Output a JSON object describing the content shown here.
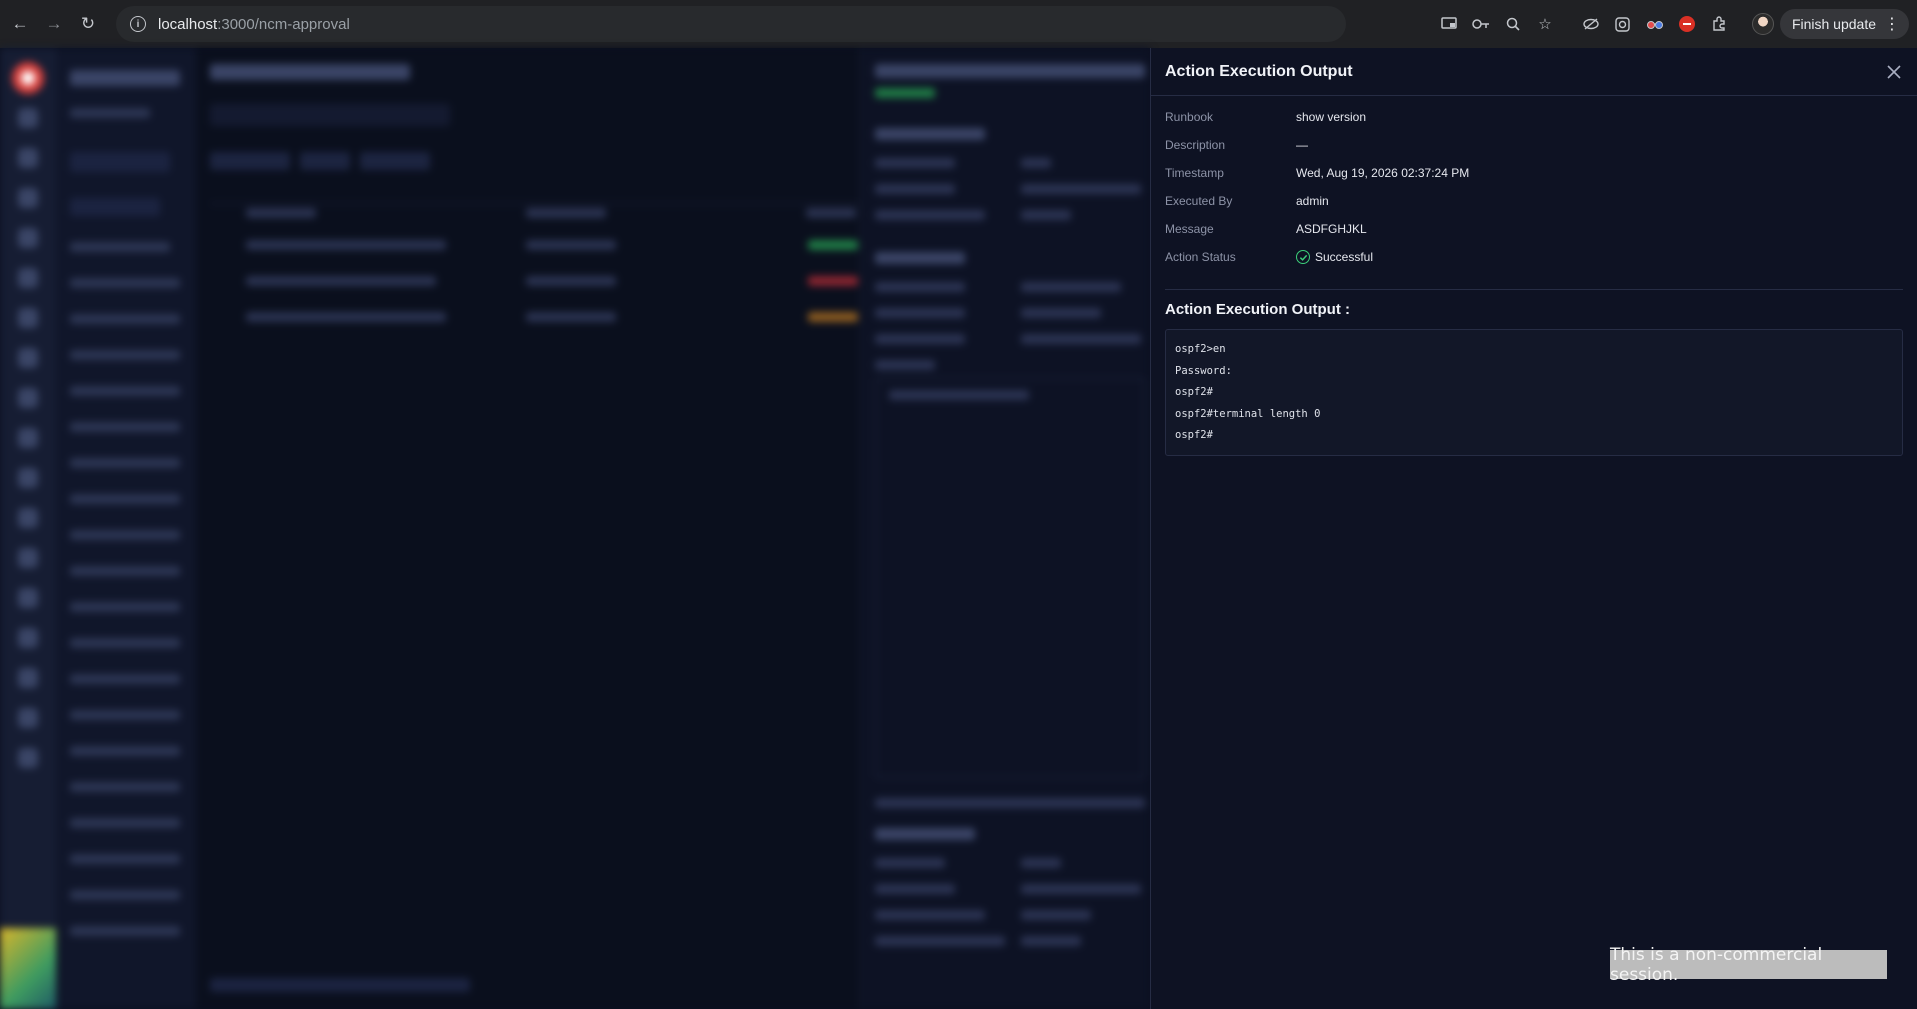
{
  "browser": {
    "url_host": "localhost",
    "url_path": ":3000/ncm-approval",
    "finish_update_label": "Finish update"
  },
  "drawer": {
    "title": "Action Execution Output",
    "fields": [
      {
        "label": "Runbook",
        "value": "show version"
      },
      {
        "label": "Description",
        "value": "—"
      },
      {
        "label": "Timestamp",
        "value": "Wed, Aug 19, 2026 02:37:24 PM"
      },
      {
        "label": "Executed By",
        "value": "admin"
      },
      {
        "label": "Message",
        "value": "ASDFGHJKL"
      },
      {
        "label": "Action Status",
        "value": "Successful"
      }
    ],
    "output_heading": "Action Execution Output :",
    "output_lines": [
      "ospf2>en",
      "Password:",
      "ospf2#",
      "ospf2#terminal length 0",
      "ospf2#"
    ]
  },
  "watermark": "This is a non-commercial session.",
  "colors": {
    "success": "#3ccf7a",
    "drawer_bg": "#0e1223",
    "page_bg": "#0b1020"
  }
}
